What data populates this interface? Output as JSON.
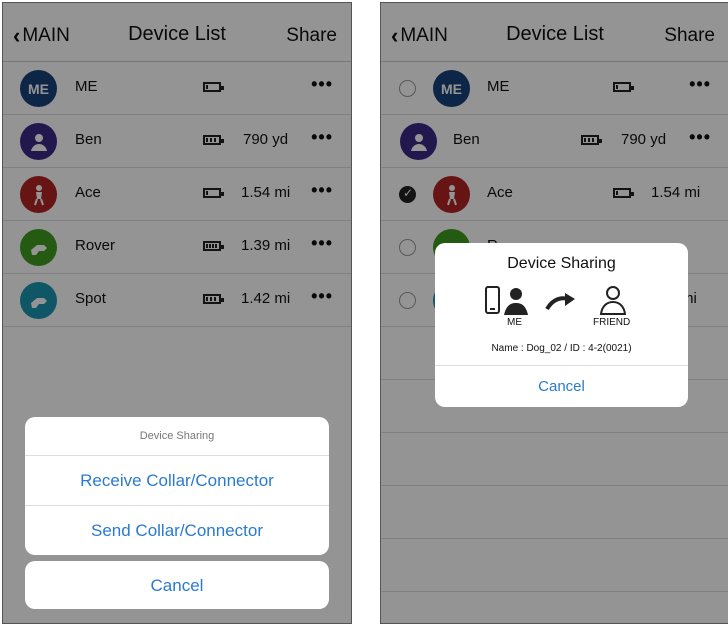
{
  "nav": {
    "back_label": "MAIN",
    "title": "Device List",
    "share_label": "Share"
  },
  "devices": [
    {
      "name": "ME",
      "avatar_text": "ME",
      "avatar_color": "#17427a",
      "battery_bars": 1,
      "distance": "",
      "more": "•••"
    },
    {
      "name": "Ben",
      "avatar_color": "#3d2a87",
      "battery_bars": 3,
      "distance": "790 yd",
      "more": "•••"
    },
    {
      "name": "Ace",
      "avatar_color": "#b02424",
      "battery_bars": 1,
      "distance": "1.54 mi",
      "more": "•••"
    },
    {
      "name": "Rover",
      "avatar_color": "#3f9c1e",
      "battery_bars": 4,
      "distance": "1.39 mi",
      "more": "•••"
    },
    {
      "name": "Spot",
      "avatar_color": "#1b97b0",
      "battery_bars": 3,
      "distance": "1.42 mi",
      "more": "•••"
    }
  ],
  "right_devices": [
    {
      "name": "ME",
      "avatar_text": "ME",
      "avatar_color": "#17427a",
      "checked": false,
      "distance": "",
      "more": "•••"
    },
    {
      "name": "Ben",
      "avatar_color": "#3d2a87",
      "checked": false,
      "distance": "790 yd",
      "more": "•••"
    },
    {
      "name": "Ace",
      "avatar_color": "#b02424",
      "checked": true,
      "distance": "1.54 mi",
      "more": ""
    },
    {
      "name": "R",
      "avatar_color": "#3f9c1e",
      "checked": false,
      "distance": "",
      "more": ""
    },
    {
      "name": "",
      "avatar_color": "#1b97b0",
      "checked": false,
      "distance": "mi",
      "more": ""
    }
  ],
  "action_sheet": {
    "title": "Device Sharing",
    "receive_label": "Receive Collar/Connector",
    "send_label": "Send Collar/Connector",
    "cancel_label": "Cancel"
  },
  "share_dialog": {
    "title": "Device Sharing",
    "me_label": "ME",
    "friend_label": "FRIEND",
    "detail": "Name : Dog_02 / ID : 4-2(0021)",
    "cancel_label": "Cancel"
  },
  "icons": [
    "chevron-left-icon",
    "battery-icon",
    "more-icon",
    "phone-icon",
    "person-icon",
    "arrow-icon",
    "friend-icon",
    "checkmark-icon"
  ]
}
